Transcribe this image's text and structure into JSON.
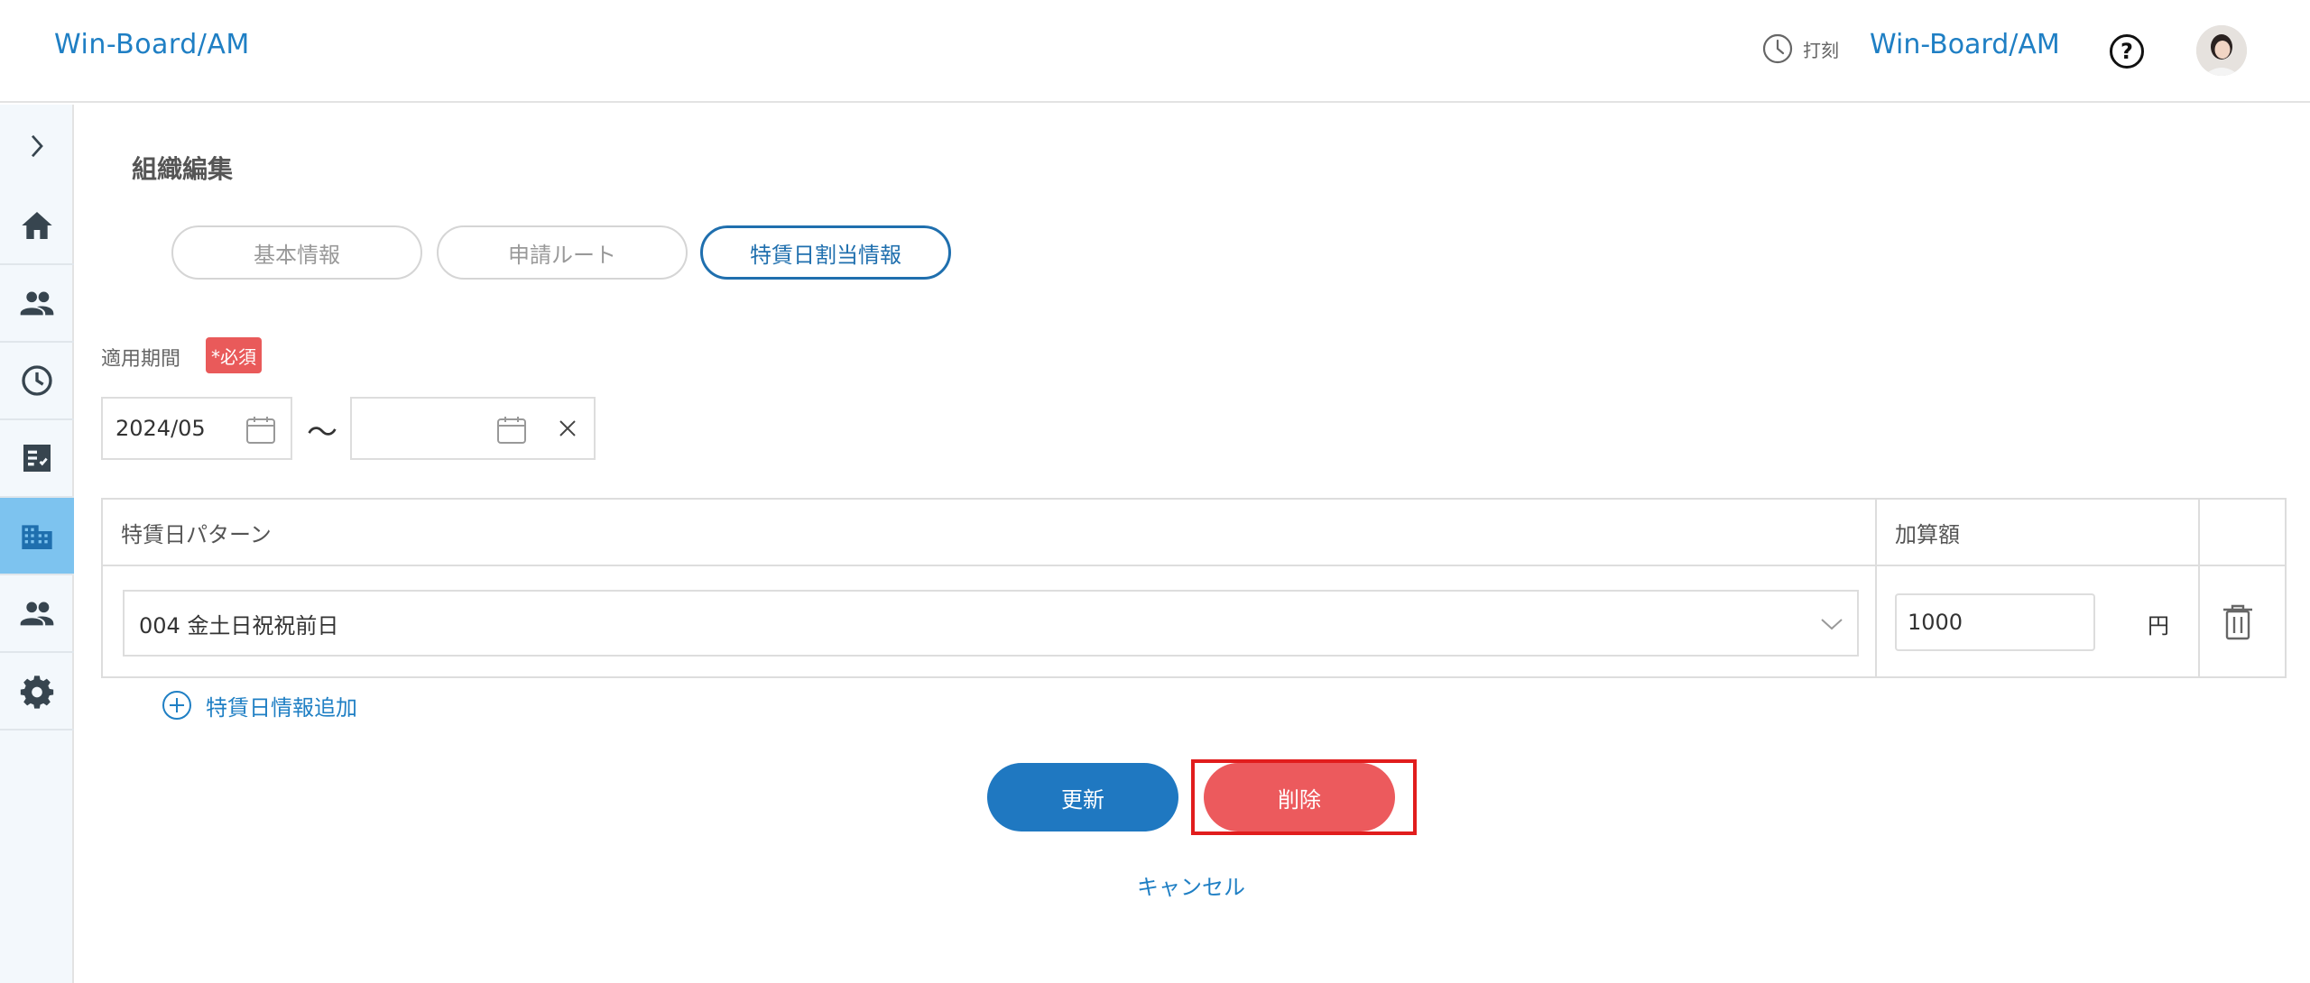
{
  "header": {
    "brand": "Win-Board/AM",
    "clock_label": "打刻",
    "org_name": "Win-Board/AM",
    "help_icon": "help-circle-icon"
  },
  "sidebar": {
    "toggle_icon": "chevron-right-icon",
    "items": [
      {
        "icon": "home-icon",
        "active": false
      },
      {
        "icon": "people-icon",
        "active": false
      },
      {
        "icon": "clock-icon",
        "active": false
      },
      {
        "icon": "checklist-icon",
        "active": false
      },
      {
        "icon": "building-icon",
        "active": true
      },
      {
        "icon": "group-icon",
        "active": false
      },
      {
        "icon": "gear-icon",
        "active": false
      }
    ]
  },
  "page": {
    "title": "組織編集",
    "tabs": [
      {
        "label": "基本情報",
        "active": false
      },
      {
        "label": "申請ルート",
        "active": false
      },
      {
        "label": "特賃日割当情報",
        "active": true
      }
    ]
  },
  "period": {
    "label": "適用期間",
    "required_badge": "*必須",
    "start_value": "2024/05",
    "end_value": "",
    "separator": "〜"
  },
  "table": {
    "headers": [
      "特賃日パターン",
      "加算額"
    ],
    "rows": [
      {
        "pattern": "004 金土日祝祝前日",
        "amount": "1000",
        "unit": "円"
      }
    ]
  },
  "actions": {
    "add_label": "特賃日情報追加",
    "update_label": "更新",
    "delete_label": "削除",
    "cancel_label": "キャンセル"
  },
  "colors": {
    "accent": "#1f78c1",
    "danger": "#ec5a5d",
    "highlight": "#e11d1d",
    "sidebar_active": "#7dc3ef"
  }
}
